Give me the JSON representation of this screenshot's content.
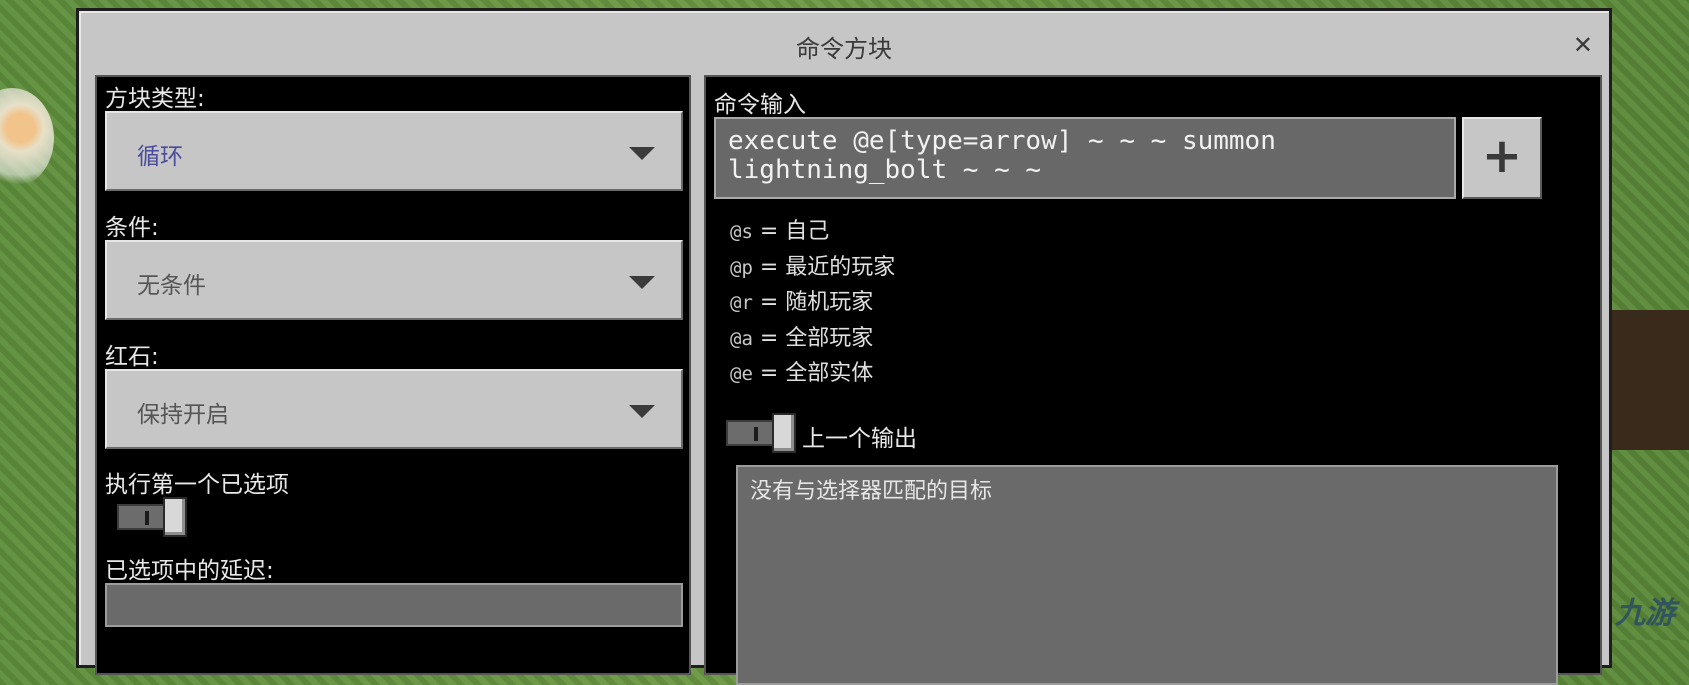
{
  "window": {
    "title": "命令方块",
    "close_icon": "close-icon"
  },
  "left": {
    "block_type_label": "方块类型:",
    "block_type_value": "循环",
    "condition_label": "条件:",
    "condition_value": "无条件",
    "redstone_label": "红石:",
    "redstone_value": "保持开启",
    "execute_first_label": "执行第一个已选项",
    "delay_label": "已选项中的延迟:"
  },
  "right": {
    "command_label": "命令输入",
    "command_line1": "execute @e[type=arrow] ~ ~ ~ summon",
    "command_line2": "lightning_bolt ~ ~ ~",
    "plus_label": "+",
    "help": [
      {
        "key": "@s",
        "text": " = 自己"
      },
      {
        "key": "@p",
        "text": " = 最近的玩家"
      },
      {
        "key": "@r",
        "text": " = 随机玩家"
      },
      {
        "key": "@a",
        "text": " = 全部玩家"
      },
      {
        "key": "@e",
        "text": " = 全部实体"
      }
    ],
    "previous_output_label": "上一个输出",
    "output_text": "没有与选择器匹配的目标"
  },
  "watermark": "九游",
  "colors": {
    "panel_bg": "#000000",
    "window_bg": "#c6c6c6",
    "accent_value": "#4b4b9e"
  }
}
